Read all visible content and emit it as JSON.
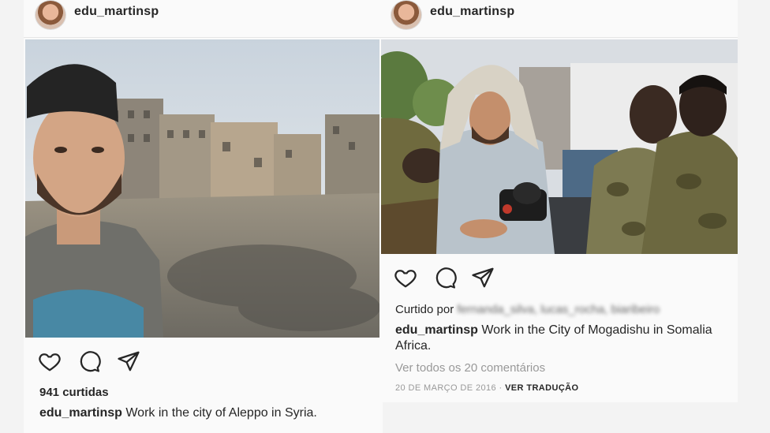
{
  "left_post": {
    "username": "edu_martinsp",
    "likes": "941 curtidas",
    "caption_user": "edu_martinsp",
    "caption_text": " Work in the city of Aleppo in Syria."
  },
  "right_post": {
    "username": "edu_martinsp",
    "liked_by_label": "Curtido por",
    "liked_by_names": "fernanda_silva, lucas_rocha, biaribeiro",
    "caption_user": "edu_martinsp",
    "caption_text": " Work in the City of Mogadishu in Somalia Africa.",
    "view_comments": "Ver todos os 20 comentários",
    "date": "20 DE MARÇO DE 2016",
    "separator": "·",
    "see_translation": "VER TRADUÇÃO"
  },
  "icons": {
    "like": "heart-icon",
    "comment": "comment-icon",
    "share": "send-icon"
  }
}
